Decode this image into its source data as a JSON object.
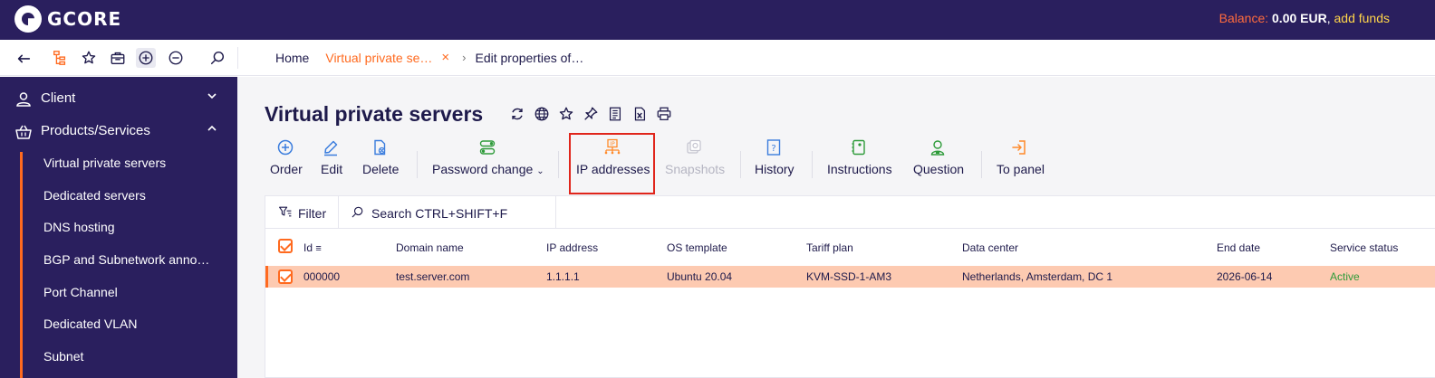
{
  "brand": {
    "name": "GCORE"
  },
  "header": {
    "balance_label": "Balance:",
    "balance_value": "0.00 EUR",
    "separator": ",",
    "add_funds": "add funds"
  },
  "toolbar": {
    "icons": [
      "back-arrow-icon",
      "tree-icon",
      "star-icon",
      "briefcase-icon",
      "zoom-in-icon",
      "zoom-out-icon",
      "search-icon"
    ]
  },
  "breadcrumbs": {
    "home": "Home",
    "current": "Virtual private se…",
    "close": "×",
    "arrow": "›",
    "next": "Edit properties of…"
  },
  "sidebar": {
    "client": "Client",
    "products": "Products/Services",
    "items": [
      "Virtual private servers",
      "Dedicated servers",
      "DNS hosting",
      "BGP and Subnetwork anno…",
      "Port Channel",
      "Dedicated VLAN",
      "Subnet"
    ]
  },
  "page": {
    "title": "Virtual private servers",
    "title_icons": [
      "refresh-icon",
      "globe-icon",
      "star-icon",
      "pin-icon",
      "list-icon",
      "excel-icon",
      "print-icon"
    ]
  },
  "actions": {
    "order": "Order",
    "edit": "Edit",
    "delete": "Delete",
    "password_change": "Password change",
    "ip_addresses": "IP addresses",
    "snapshots": "Snapshots",
    "history": "History",
    "instructions": "Instructions",
    "question": "Question",
    "to_panel": "To panel"
  },
  "filterbar": {
    "filter": "Filter",
    "search": "Search CTRL+SHIFT+F"
  },
  "table": {
    "columns": [
      "Id",
      "Domain name",
      "IP address",
      "OS template",
      "Tariff plan",
      "Data center",
      "End date",
      "Service status"
    ],
    "rows": [
      {
        "id": "000000",
        "domain": "test.server.com",
        "ip": "1.1.1.1",
        "os": "Ubuntu 20.04",
        "tariff": "KVM-SSD-1-AM3",
        "datacenter": "Netherlands, Amsterdam, DC 1",
        "end_date": "2026-06-14",
        "status": "Active"
      }
    ]
  },
  "colors": {
    "navy": "#2a1f5e",
    "accent": "#ff6a1f",
    "row_selected": "#fdcab1",
    "status_active": "#2e9b3a",
    "highlight": "#e0251b"
  }
}
